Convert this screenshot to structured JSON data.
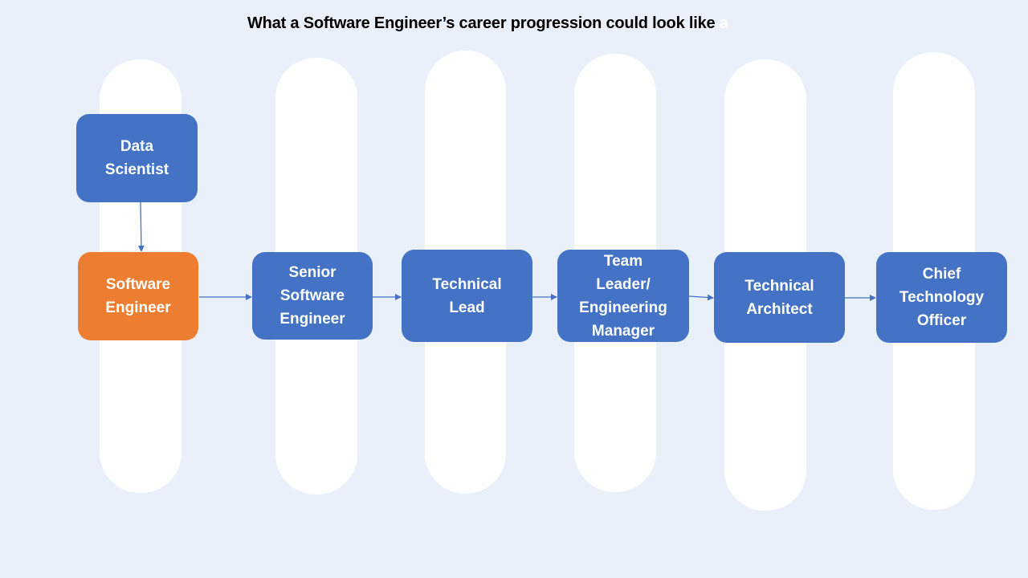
{
  "title": "What a Software Engineer’s career progression could look like",
  "title_trailing_hidden": "a",
  "colors": {
    "background": "#e9f0fa",
    "column": "#ffffff",
    "node": "#4472c4",
    "current_node": "#ed7d31",
    "connector": "#4472c4"
  },
  "nodes": [
    {
      "id": "data-scientist",
      "label": "Data\nScientist",
      "current": false
    },
    {
      "id": "software-engineer",
      "label": "Software\nEngineer",
      "current": true
    },
    {
      "id": "senior-software-engineer",
      "label": "Senior\nSoftware\nEngineer",
      "current": false
    },
    {
      "id": "technical-lead",
      "label": "Technical\nLead",
      "current": false
    },
    {
      "id": "team-leader",
      "label": "Team\nLeader/\nEngineering\nManager",
      "current": false
    },
    {
      "id": "technical-architect",
      "label": "Technical\nArchitect",
      "current": false
    },
    {
      "id": "cto",
      "label": "Chief\nTechnology\nOfficer",
      "current": false
    }
  ],
  "edges": [
    {
      "from": "data-scientist",
      "to": "software-engineer"
    },
    {
      "from": "software-engineer",
      "to": "senior-software-engineer"
    },
    {
      "from": "senior-software-engineer",
      "to": "technical-lead"
    },
    {
      "from": "technical-lead",
      "to": "team-leader"
    },
    {
      "from": "team-leader",
      "to": "technical-architect"
    },
    {
      "from": "technical-architect",
      "to": "cto"
    }
  ]
}
